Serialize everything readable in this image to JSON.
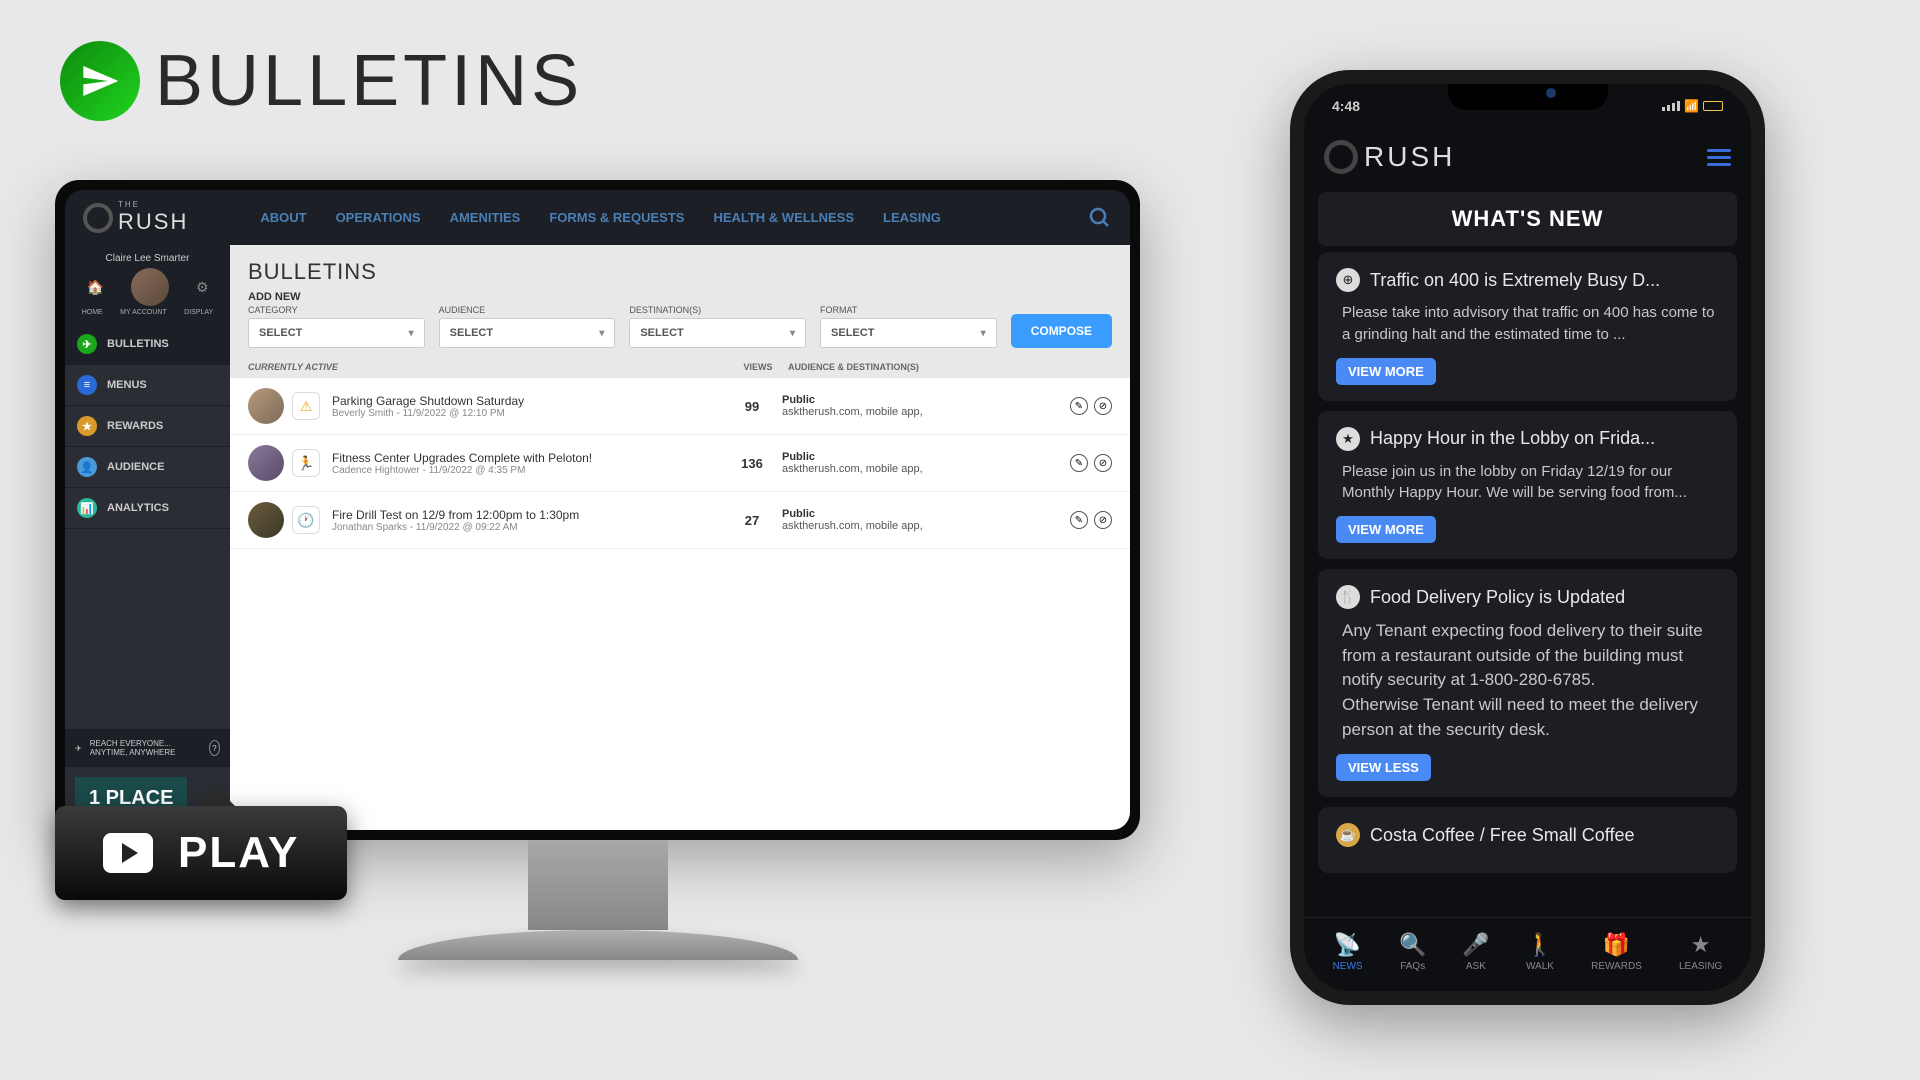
{
  "title": "BULLETINS",
  "play_label": "PLAY",
  "desktop": {
    "logo_the": "THE",
    "logo_text": "RUSH",
    "nav": [
      "ABOUT",
      "OPERATIONS",
      "AMENITIES",
      "FORMS & REQUESTS",
      "HEALTH & WELLNESS",
      "LEASING"
    ],
    "user": {
      "name": "Claire Lee Smarter",
      "labels": [
        "HOME",
        "MY ACCOUNT",
        "DISPLAY"
      ]
    },
    "sidebar": [
      {
        "label": "BULLETINS",
        "color": "#1aa81a",
        "glyph": "✈"
      },
      {
        "label": "MENUS",
        "color": "#2a6ad8",
        "glyph": "≡"
      },
      {
        "label": "REWARDS",
        "color": "#d89a2a",
        "glyph": "★"
      },
      {
        "label": "AUDIENCE",
        "color": "#4a9ad8",
        "glyph": "👤"
      },
      {
        "label": "ANALYTICS",
        "color": "#2ab89a",
        "glyph": "📊"
      }
    ],
    "sidebar_banner": "REACH EVERYONE... ANYTIME, ANYWHERE",
    "place_logo": "1 PLACE",
    "main": {
      "title": "BULLETINS",
      "add_new": "ADD NEW",
      "filters": [
        {
          "label": "CATEGORY",
          "value": "SELECT"
        },
        {
          "label": "AUDIENCE",
          "value": "SELECT"
        },
        {
          "label": "DESTINATION(S)",
          "value": "SELECT"
        },
        {
          "label": "FORMAT",
          "value": "SELECT"
        }
      ],
      "compose": "COMPOSE",
      "table_headers": {
        "active": "CURRENTLY ACTIVE",
        "views": "VIEWS",
        "aud": "AUDIENCE & DESTINATION(S)"
      },
      "rows": [
        {
          "title": "Parking Garage Shutdown Saturday",
          "meta": "Beverly Smith - 11/9/2022 @ 12:10 PM",
          "views": "99",
          "aud_label": "Public",
          "aud_dest": "asktherush.com, mobile app,",
          "badge": "⚠",
          "badge_bg": "#f5a623"
        },
        {
          "title": "Fitness Center Upgrades Complete with Peloton!",
          "meta": "Cadence Hightower - 11/9/2022 @ 4:35 PM",
          "views": "136",
          "aud_label": "Public",
          "aud_dest": "asktherush.com, mobile app,",
          "badge": "🏃",
          "badge_bg": "#4ab84a"
        },
        {
          "title": "Fire Drill Test on 12/9 from 12:00pm to 1:30pm",
          "meta": "Jonathan Sparks - 11/9/2022 @ 09:22 AM",
          "views": "27",
          "aud_label": "Public",
          "aud_dest": "asktherush.com, mobile app,",
          "badge": "🕐",
          "badge_bg": "#4ab8a8"
        }
      ]
    }
  },
  "phone": {
    "time": "4:48",
    "logo_text": "RUSH",
    "section_title": "WHAT'S NEW",
    "cards": [
      {
        "icon": "⊕",
        "title": "Traffic on 400 is Extremely Busy D...",
        "body": "Please take into advisory that traffic on 400 has come to a grinding halt and the estimated time to ...",
        "btn": "VIEW MORE"
      },
      {
        "icon": "★",
        "title": "Happy Hour in the Lobby on Frida...",
        "body": "Please join us in the lobby on Friday 12/19 for our Monthly Happy Hour. We will be serving food from...",
        "btn": "VIEW MORE"
      },
      {
        "icon": "🍴",
        "title": "Food Delivery Policy is Updated",
        "body": "Any Tenant expecting food delivery to their suite from a restaurant outside of the building must notify security at 1-800-280-6785.\nOtherwise Tenant will need to meet the delivery person at the security desk.",
        "btn": "VIEW LESS"
      },
      {
        "icon": "☕",
        "title": "Costa Coffee / Free Small Coffee",
        "body": "",
        "btn": ""
      }
    ],
    "tabs": [
      {
        "label": "NEWS",
        "icon": "📡"
      },
      {
        "label": "FAQs",
        "icon": "🔍"
      },
      {
        "label": "ASK",
        "icon": "🎤"
      },
      {
        "label": "WALK",
        "icon": "🚶"
      },
      {
        "label": "REWARDS",
        "icon": "🎁"
      },
      {
        "label": "LEASING",
        "icon": "★"
      }
    ]
  }
}
